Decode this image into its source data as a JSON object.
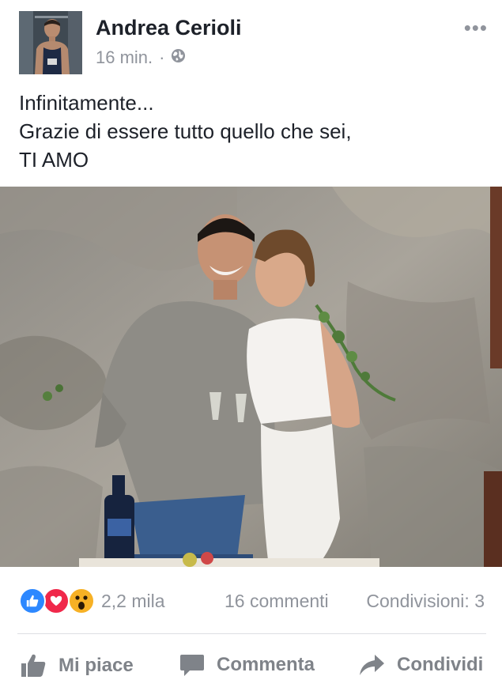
{
  "post": {
    "author": "Andrea Cerioli",
    "time": "16 min.",
    "separator": "·",
    "more_label": "•••",
    "caption_lines": [
      "Infinitamente...",
      "Grazie di essere tutto quello che sei,",
      "TI AMO"
    ]
  },
  "stats": {
    "reactions_count": "2,2 mila",
    "comments": "16 commenti",
    "shares": "Condivisioni: 3",
    "reaction_types": [
      "like",
      "love",
      "wow"
    ]
  },
  "actions": {
    "like_label": "Mi piace",
    "comment_label": "Commenta",
    "share_label": "Condividi"
  },
  "icons": {
    "like_color": "#2d88ff",
    "love_color": "#f0284a",
    "wow_color": "#f7b125",
    "action_icon_color": "#7f8389",
    "meta_color": "#90949c"
  }
}
